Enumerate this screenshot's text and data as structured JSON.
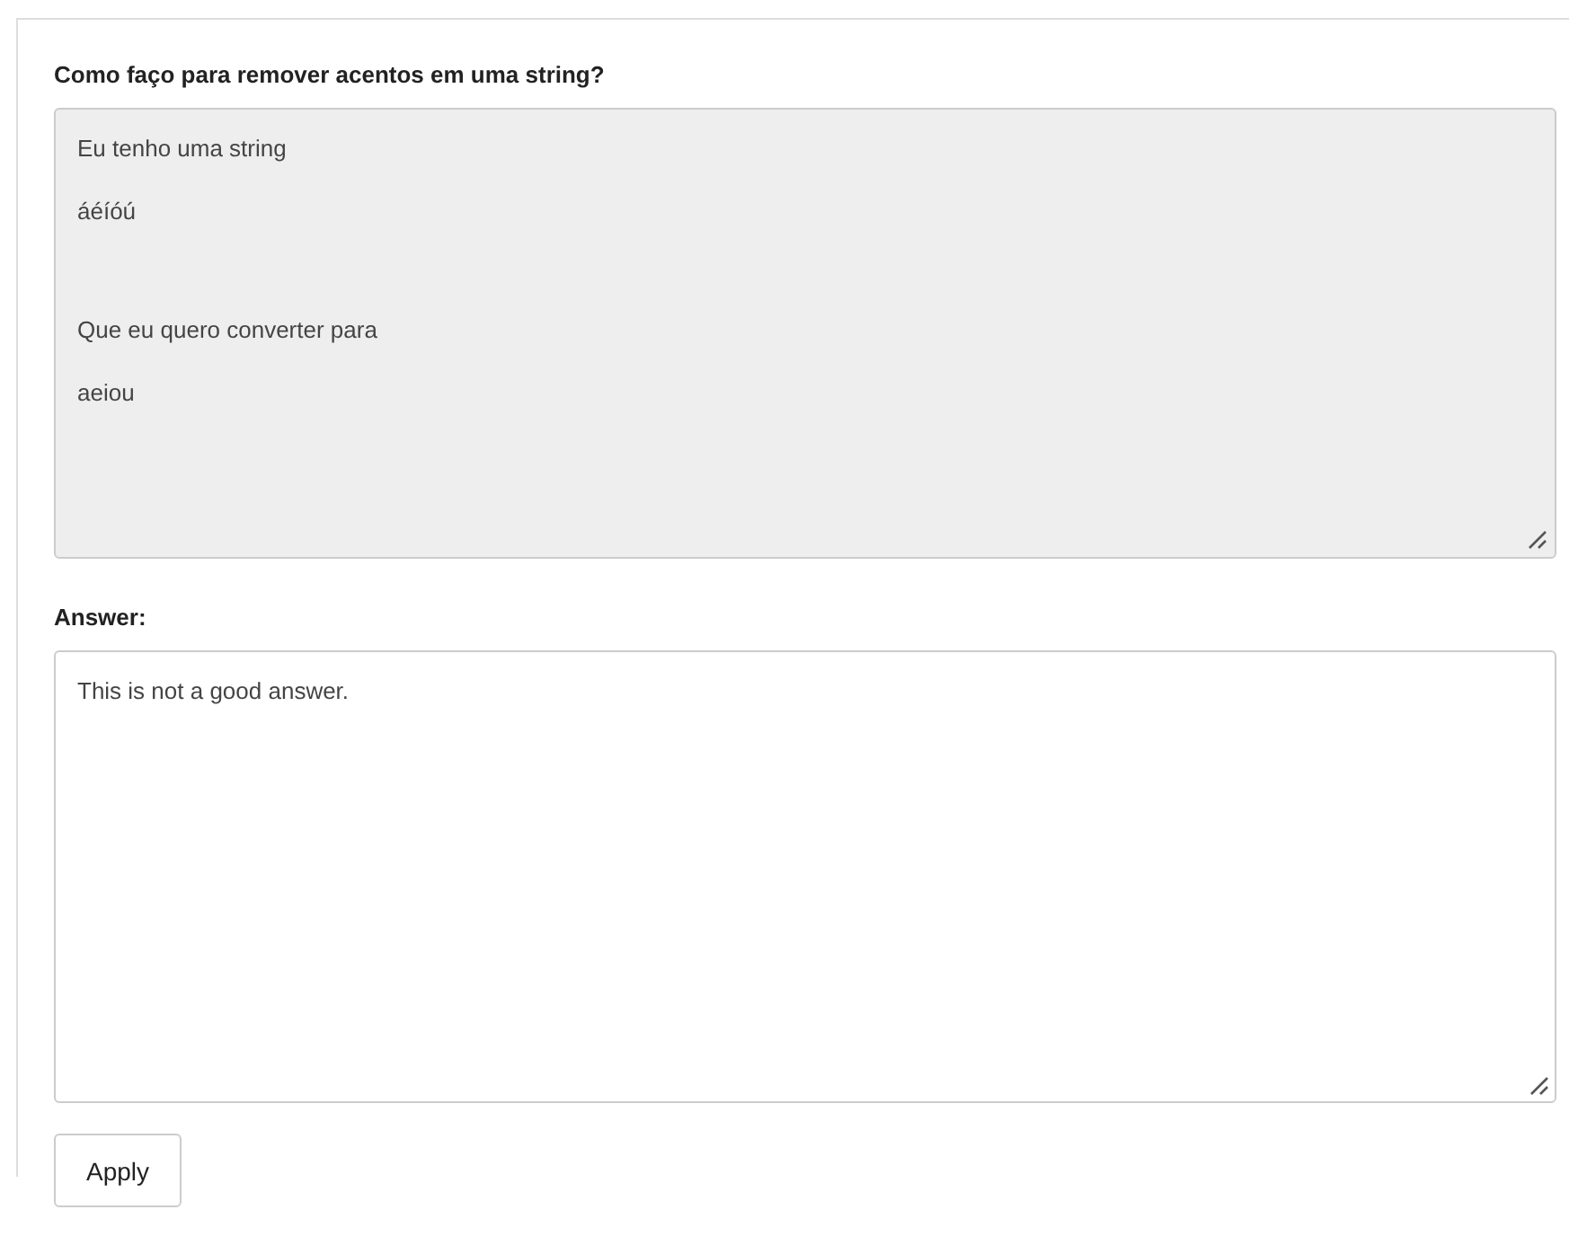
{
  "question": {
    "title": "Como faço para remover acentos em uma string?",
    "disabled": true,
    "lines": [
      "Eu tenho uma string",
      "áéíóú",
      "Que eu quero converter para",
      "aeiou"
    ]
  },
  "answer": {
    "label": "Answer:",
    "value": "This is not a good answer."
  },
  "buttons": [
    "Apply"
  ]
}
